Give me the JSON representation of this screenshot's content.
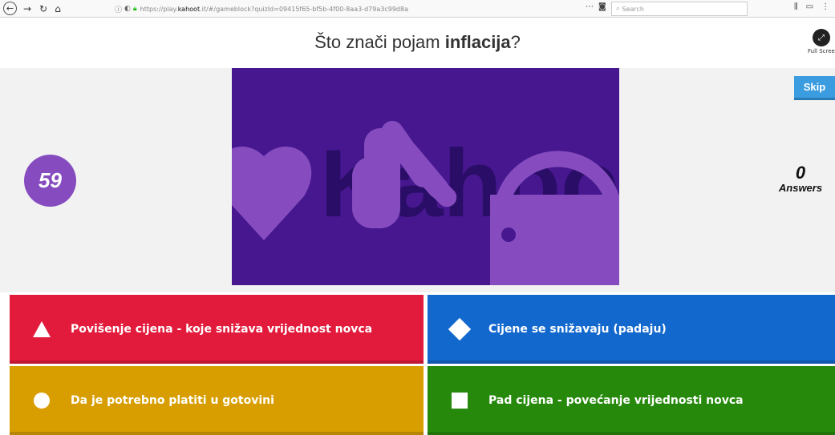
{
  "browser": {
    "url_prefix": "https://play.",
    "url_domain": "kahoot",
    "url_rest": ".it/#/gameblock?quizId=09415f65-bf5b-4f00-8aa3-d79a3c99d8a",
    "search_placeholder": "Search",
    "more_label": "⋯"
  },
  "question": {
    "prefix": "Što znači pojam ",
    "keyword": "inflacija",
    "suffix": "?"
  },
  "fullscreen_label": "Full Screen",
  "timer": "59",
  "skip_label": "Skip",
  "answers": {
    "count": "0",
    "label": "Answers"
  },
  "choices": [
    {
      "shape": "triangle",
      "text": "Povišenje cijena - koje snižava vrijednost novca",
      "color": "#e21b3c"
    },
    {
      "shape": "diamond",
      "text": "Cijene se snižavaju (padaju)",
      "color": "#1368ce"
    },
    {
      "shape": "circle",
      "text": "Da je potrebno platiti u gotovini",
      "color": "#d89e00"
    },
    {
      "shape": "square",
      "text": "Pad cijena - povećanje vrijednosti novca",
      "color": "#26890c"
    }
  ],
  "media": {
    "watermark": "Kahoot!",
    "bg_color": "#46178f",
    "shape_color": "#864cbf"
  }
}
